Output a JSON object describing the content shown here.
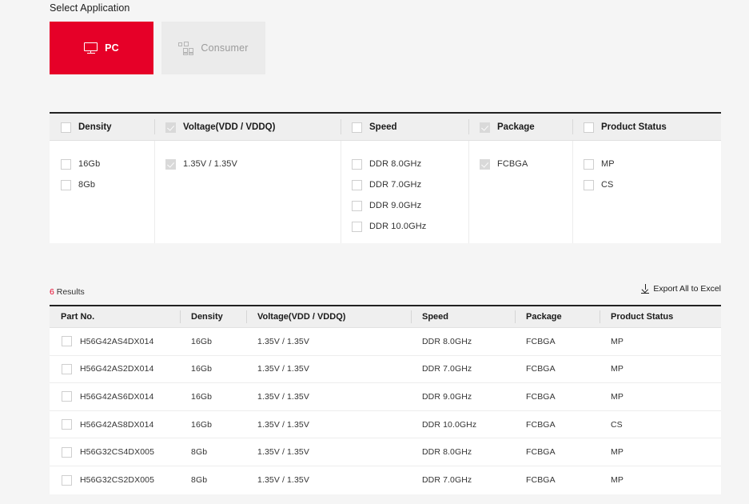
{
  "select_application": {
    "title": "Select Application",
    "options": [
      {
        "label": "PC",
        "icon": "monitor-icon",
        "selected": true,
        "color": "#e60028"
      },
      {
        "label": "Consumer",
        "icon": "blocks-icon",
        "selected": false,
        "color": "#ebebeb"
      }
    ]
  },
  "filters": {
    "columns": [
      {
        "header": "Density",
        "checked": false,
        "options": [
          {
            "label": "16Gb",
            "checked": false
          },
          {
            "label": "8Gb",
            "checked": false
          }
        ]
      },
      {
        "header": "Voltage(VDD / VDDQ)",
        "checked": true,
        "options": [
          {
            "label": "1.35V / 1.35V",
            "checked": true
          }
        ]
      },
      {
        "header": "Speed",
        "checked": false,
        "options": [
          {
            "label": "DDR 8.0GHz",
            "checked": false
          },
          {
            "label": "DDR 7.0GHz",
            "checked": false
          },
          {
            "label": "DDR 9.0GHz",
            "checked": false
          },
          {
            "label": "DDR 10.0GHz",
            "checked": false
          }
        ]
      },
      {
        "header": "Package",
        "checked": true,
        "options": [
          {
            "label": "FCBGA",
            "checked": true
          }
        ]
      },
      {
        "header": "Product Status",
        "checked": false,
        "options": [
          {
            "label": "MP",
            "checked": false
          },
          {
            "label": "CS",
            "checked": false
          }
        ]
      }
    ]
  },
  "results": {
    "count": "6",
    "count_suffix": " Results",
    "export_label": "Export All to Excel",
    "export_icon": "download-icon",
    "accent_color": "#e60028",
    "columns": [
      "Part No.",
      "Density",
      "Voltage(VDD / VDDQ)",
      "Speed",
      "Package",
      "Product Status"
    ],
    "rows": [
      {
        "part_no": "H56G42AS4DX014",
        "density": "16Gb",
        "voltage": "1.35V / 1.35V",
        "speed": "DDR 8.0GHz",
        "package": "FCBGA",
        "status": "MP",
        "checked": false
      },
      {
        "part_no": "H56G42AS2DX014",
        "density": "16Gb",
        "voltage": "1.35V / 1.35V",
        "speed": "DDR 7.0GHz",
        "package": "FCBGA",
        "status": "MP",
        "checked": false
      },
      {
        "part_no": "H56G42AS6DX014",
        "density": "16Gb",
        "voltage": "1.35V / 1.35V",
        "speed": "DDR 9.0GHz",
        "package": "FCBGA",
        "status": "MP",
        "checked": false
      },
      {
        "part_no": "H56G42AS8DX014",
        "density": "16Gb",
        "voltage": "1.35V / 1.35V",
        "speed": "DDR 10.0GHz",
        "package": "FCBGA",
        "status": "CS",
        "checked": false
      },
      {
        "part_no": "H56G32CS4DX005",
        "density": "8Gb",
        "voltage": "1.35V / 1.35V",
        "speed": "DDR 8.0GHz",
        "package": "FCBGA",
        "status": "MP",
        "checked": false
      },
      {
        "part_no": "H56G32CS2DX005",
        "density": "8Gb",
        "voltage": "1.35V / 1.35V",
        "speed": "DDR 7.0GHz",
        "package": "FCBGA",
        "status": "MP",
        "checked": false
      }
    ]
  }
}
